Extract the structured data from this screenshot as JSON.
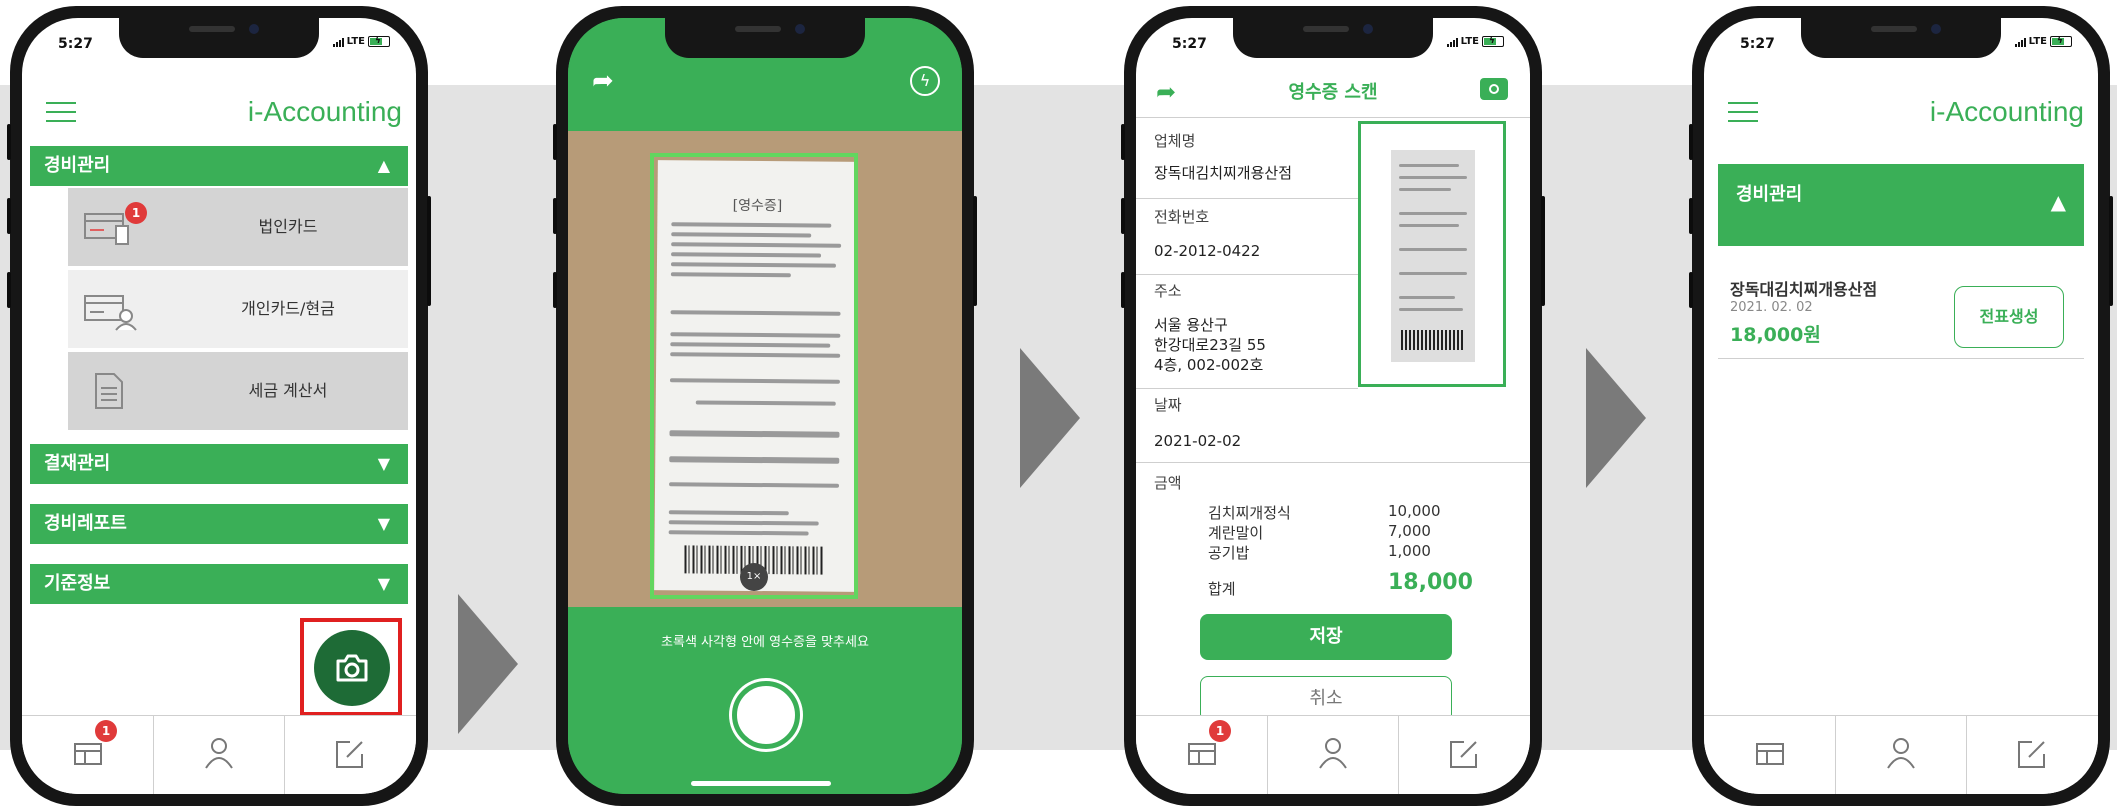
{
  "status_bar": {
    "time": "5:27",
    "network": "LTE"
  },
  "screen1": {
    "app_title": "i-Accounting",
    "sections": [
      {
        "label": "경비관리",
        "arrow": "▲"
      },
      {
        "label": "결재관리",
        "arrow": "▼"
      },
      {
        "label": "경비레포트",
        "arrow": "▼"
      },
      {
        "label": "기준정보",
        "arrow": "▼"
      }
    ],
    "submenu": [
      {
        "label": "법인카드",
        "badge": "1",
        "icon": "card-receipt-icon"
      },
      {
        "label": "개인카드/현금",
        "icon": "card-person-icon"
      },
      {
        "label": "세금 계산서",
        "icon": "document-icon"
      }
    ],
    "tab_badge": "1",
    "highlight_color": "#e02020"
  },
  "screen2": {
    "instruction": "초록색 사각형 안에 영수증을 맞추세요",
    "zoom_label": "1×",
    "receipt_heading": "[영수증]"
  },
  "screen3": {
    "title": "영수증 스캔",
    "fields": {
      "vendor_label": "업체명",
      "vendor": "장독대김치찌개용산점",
      "phone_label": "전화번호",
      "phone": "02-2012-0422",
      "address_label": "주소",
      "address_line1": "서울 용산구",
      "address_line2": "한강대로23길 55",
      "address_line3": "4층, 002-002호",
      "date_label": "날짜",
      "date": "2021-02-02",
      "amount_label": "금액"
    },
    "items": [
      {
        "name": "김치찌개정식",
        "price": "10,000"
      },
      {
        "name": "계란말이",
        "price": "7,000"
      },
      {
        "name": "공기밥",
        "price": "1,000"
      }
    ],
    "total_label": "합계",
    "total": "18,000",
    "save_label": "저장",
    "cancel_label": "취소",
    "tab_badge": "1"
  },
  "screen4": {
    "app_title": "i-Accounting",
    "section_label": "경비관리",
    "section_arrow": "▲",
    "entry": {
      "vendor": "장독대김치찌개용산점",
      "date": "2021. 02. 02",
      "amount": "18,000원",
      "action_label": "전표생성"
    }
  },
  "colors": {
    "brand_green": "#3aaf57",
    "arrow_gray": "#7a7a7a",
    "badge_red": "#e03a3a"
  }
}
